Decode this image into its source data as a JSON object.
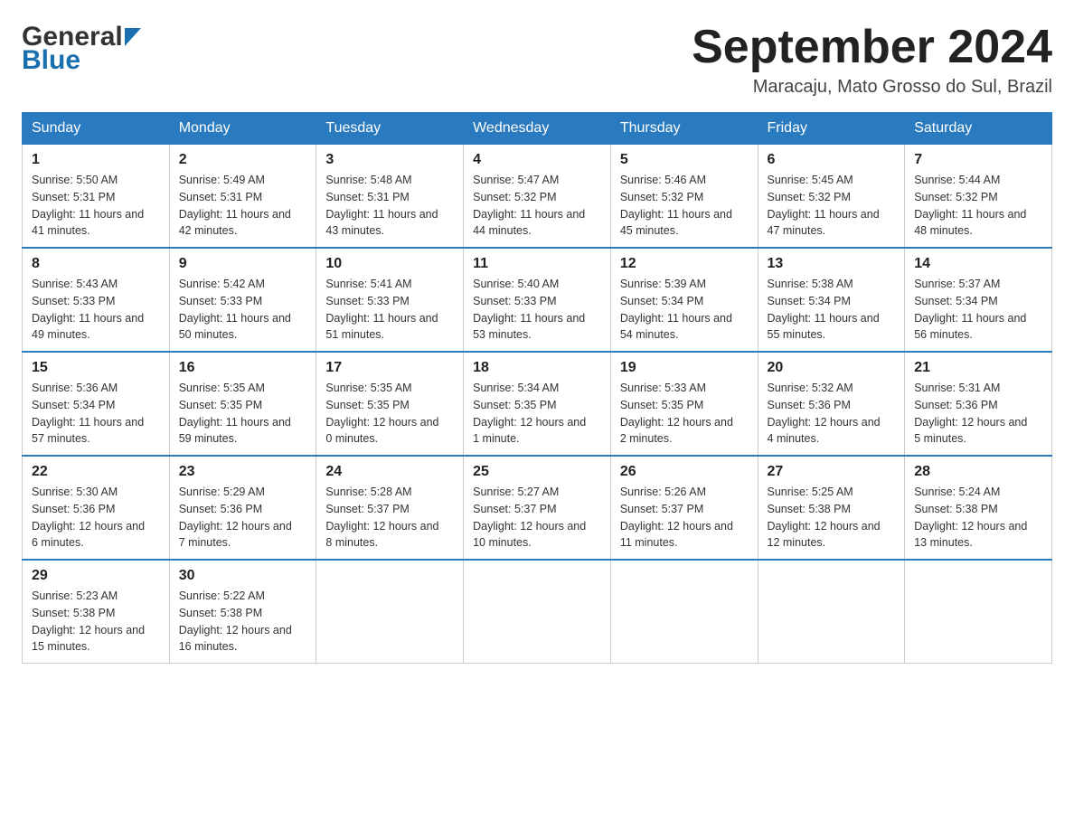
{
  "header": {
    "logo_general": "General",
    "logo_blue": "Blue",
    "title": "September 2024",
    "location": "Maracaju, Mato Grosso do Sul, Brazil"
  },
  "days_of_week": [
    "Sunday",
    "Monday",
    "Tuesday",
    "Wednesday",
    "Thursday",
    "Friday",
    "Saturday"
  ],
  "weeks": [
    [
      {
        "day": "1",
        "sunrise": "5:50 AM",
        "sunset": "5:31 PM",
        "daylight": "11 hours and 41 minutes."
      },
      {
        "day": "2",
        "sunrise": "5:49 AM",
        "sunset": "5:31 PM",
        "daylight": "11 hours and 42 minutes."
      },
      {
        "day": "3",
        "sunrise": "5:48 AM",
        "sunset": "5:31 PM",
        "daylight": "11 hours and 43 minutes."
      },
      {
        "day": "4",
        "sunrise": "5:47 AM",
        "sunset": "5:32 PM",
        "daylight": "11 hours and 44 minutes."
      },
      {
        "day": "5",
        "sunrise": "5:46 AM",
        "sunset": "5:32 PM",
        "daylight": "11 hours and 45 minutes."
      },
      {
        "day": "6",
        "sunrise": "5:45 AM",
        "sunset": "5:32 PM",
        "daylight": "11 hours and 47 minutes."
      },
      {
        "day": "7",
        "sunrise": "5:44 AM",
        "sunset": "5:32 PM",
        "daylight": "11 hours and 48 minutes."
      }
    ],
    [
      {
        "day": "8",
        "sunrise": "5:43 AM",
        "sunset": "5:33 PM",
        "daylight": "11 hours and 49 minutes."
      },
      {
        "day": "9",
        "sunrise": "5:42 AM",
        "sunset": "5:33 PM",
        "daylight": "11 hours and 50 minutes."
      },
      {
        "day": "10",
        "sunrise": "5:41 AM",
        "sunset": "5:33 PM",
        "daylight": "11 hours and 51 minutes."
      },
      {
        "day": "11",
        "sunrise": "5:40 AM",
        "sunset": "5:33 PM",
        "daylight": "11 hours and 53 minutes."
      },
      {
        "day": "12",
        "sunrise": "5:39 AM",
        "sunset": "5:34 PM",
        "daylight": "11 hours and 54 minutes."
      },
      {
        "day": "13",
        "sunrise": "5:38 AM",
        "sunset": "5:34 PM",
        "daylight": "11 hours and 55 minutes."
      },
      {
        "day": "14",
        "sunrise": "5:37 AM",
        "sunset": "5:34 PM",
        "daylight": "11 hours and 56 minutes."
      }
    ],
    [
      {
        "day": "15",
        "sunrise": "5:36 AM",
        "sunset": "5:34 PM",
        "daylight": "11 hours and 57 minutes."
      },
      {
        "day": "16",
        "sunrise": "5:35 AM",
        "sunset": "5:35 PM",
        "daylight": "11 hours and 59 minutes."
      },
      {
        "day": "17",
        "sunrise": "5:35 AM",
        "sunset": "5:35 PM",
        "daylight": "12 hours and 0 minutes."
      },
      {
        "day": "18",
        "sunrise": "5:34 AM",
        "sunset": "5:35 PM",
        "daylight": "12 hours and 1 minute."
      },
      {
        "day": "19",
        "sunrise": "5:33 AM",
        "sunset": "5:35 PM",
        "daylight": "12 hours and 2 minutes."
      },
      {
        "day": "20",
        "sunrise": "5:32 AM",
        "sunset": "5:36 PM",
        "daylight": "12 hours and 4 minutes."
      },
      {
        "day": "21",
        "sunrise": "5:31 AM",
        "sunset": "5:36 PM",
        "daylight": "12 hours and 5 minutes."
      }
    ],
    [
      {
        "day": "22",
        "sunrise": "5:30 AM",
        "sunset": "5:36 PM",
        "daylight": "12 hours and 6 minutes."
      },
      {
        "day": "23",
        "sunrise": "5:29 AM",
        "sunset": "5:36 PM",
        "daylight": "12 hours and 7 minutes."
      },
      {
        "day": "24",
        "sunrise": "5:28 AM",
        "sunset": "5:37 PM",
        "daylight": "12 hours and 8 minutes."
      },
      {
        "day": "25",
        "sunrise": "5:27 AM",
        "sunset": "5:37 PM",
        "daylight": "12 hours and 10 minutes."
      },
      {
        "day": "26",
        "sunrise": "5:26 AM",
        "sunset": "5:37 PM",
        "daylight": "12 hours and 11 minutes."
      },
      {
        "day": "27",
        "sunrise": "5:25 AM",
        "sunset": "5:38 PM",
        "daylight": "12 hours and 12 minutes."
      },
      {
        "day": "28",
        "sunrise": "5:24 AM",
        "sunset": "5:38 PM",
        "daylight": "12 hours and 13 minutes."
      }
    ],
    [
      {
        "day": "29",
        "sunrise": "5:23 AM",
        "sunset": "5:38 PM",
        "daylight": "12 hours and 15 minutes."
      },
      {
        "day": "30",
        "sunrise": "5:22 AM",
        "sunset": "5:38 PM",
        "daylight": "12 hours and 16 minutes."
      },
      null,
      null,
      null,
      null,
      null
    ]
  ],
  "labels": {
    "sunrise": "Sunrise:",
    "sunset": "Sunset:",
    "daylight": "Daylight:"
  }
}
